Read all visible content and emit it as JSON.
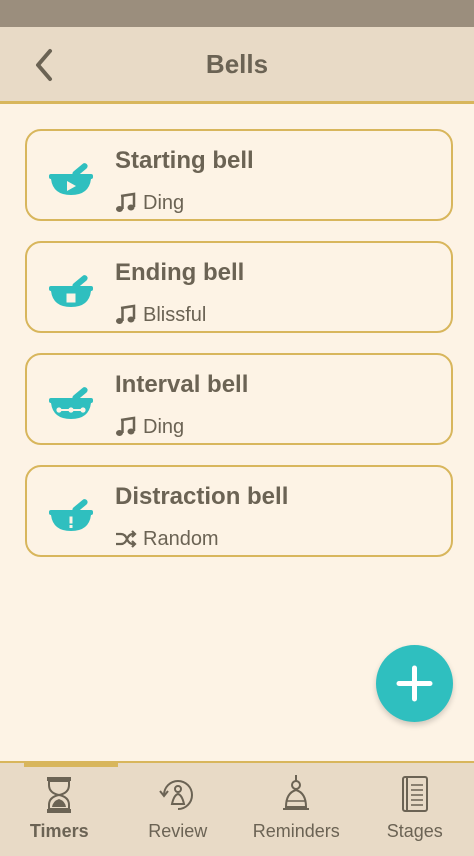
{
  "header": {
    "title": "Bells"
  },
  "bells": [
    {
      "name": "Starting bell",
      "sound": "Ding",
      "sound_icon": "music-note-icon",
      "bowl_icon": "play-icon"
    },
    {
      "name": "Ending bell",
      "sound": "Blissful",
      "sound_icon": "music-note-icon",
      "bowl_icon": "stop-icon"
    },
    {
      "name": "Interval bell",
      "sound": "Ding",
      "sound_icon": "music-note-icon",
      "bowl_icon": "interval-icon"
    },
    {
      "name": "Distraction bell",
      "sound": "Random",
      "sound_icon": "shuffle-icon",
      "bowl_icon": "exclamation-icon"
    }
  ],
  "nav": [
    {
      "label": "Timers",
      "icon": "hourglass-icon",
      "active": true
    },
    {
      "label": "Review",
      "icon": "meditation-review-icon",
      "active": false
    },
    {
      "label": "Reminders",
      "icon": "bell-reminder-icon",
      "active": false
    },
    {
      "label": "Stages",
      "icon": "stages-book-icon",
      "active": false
    }
  ],
  "colors": {
    "accent": "#2fbfbf",
    "border": "#d8b65c",
    "text": "#6b6354",
    "background": "#fdf3e5",
    "header": "#e8dac6"
  }
}
